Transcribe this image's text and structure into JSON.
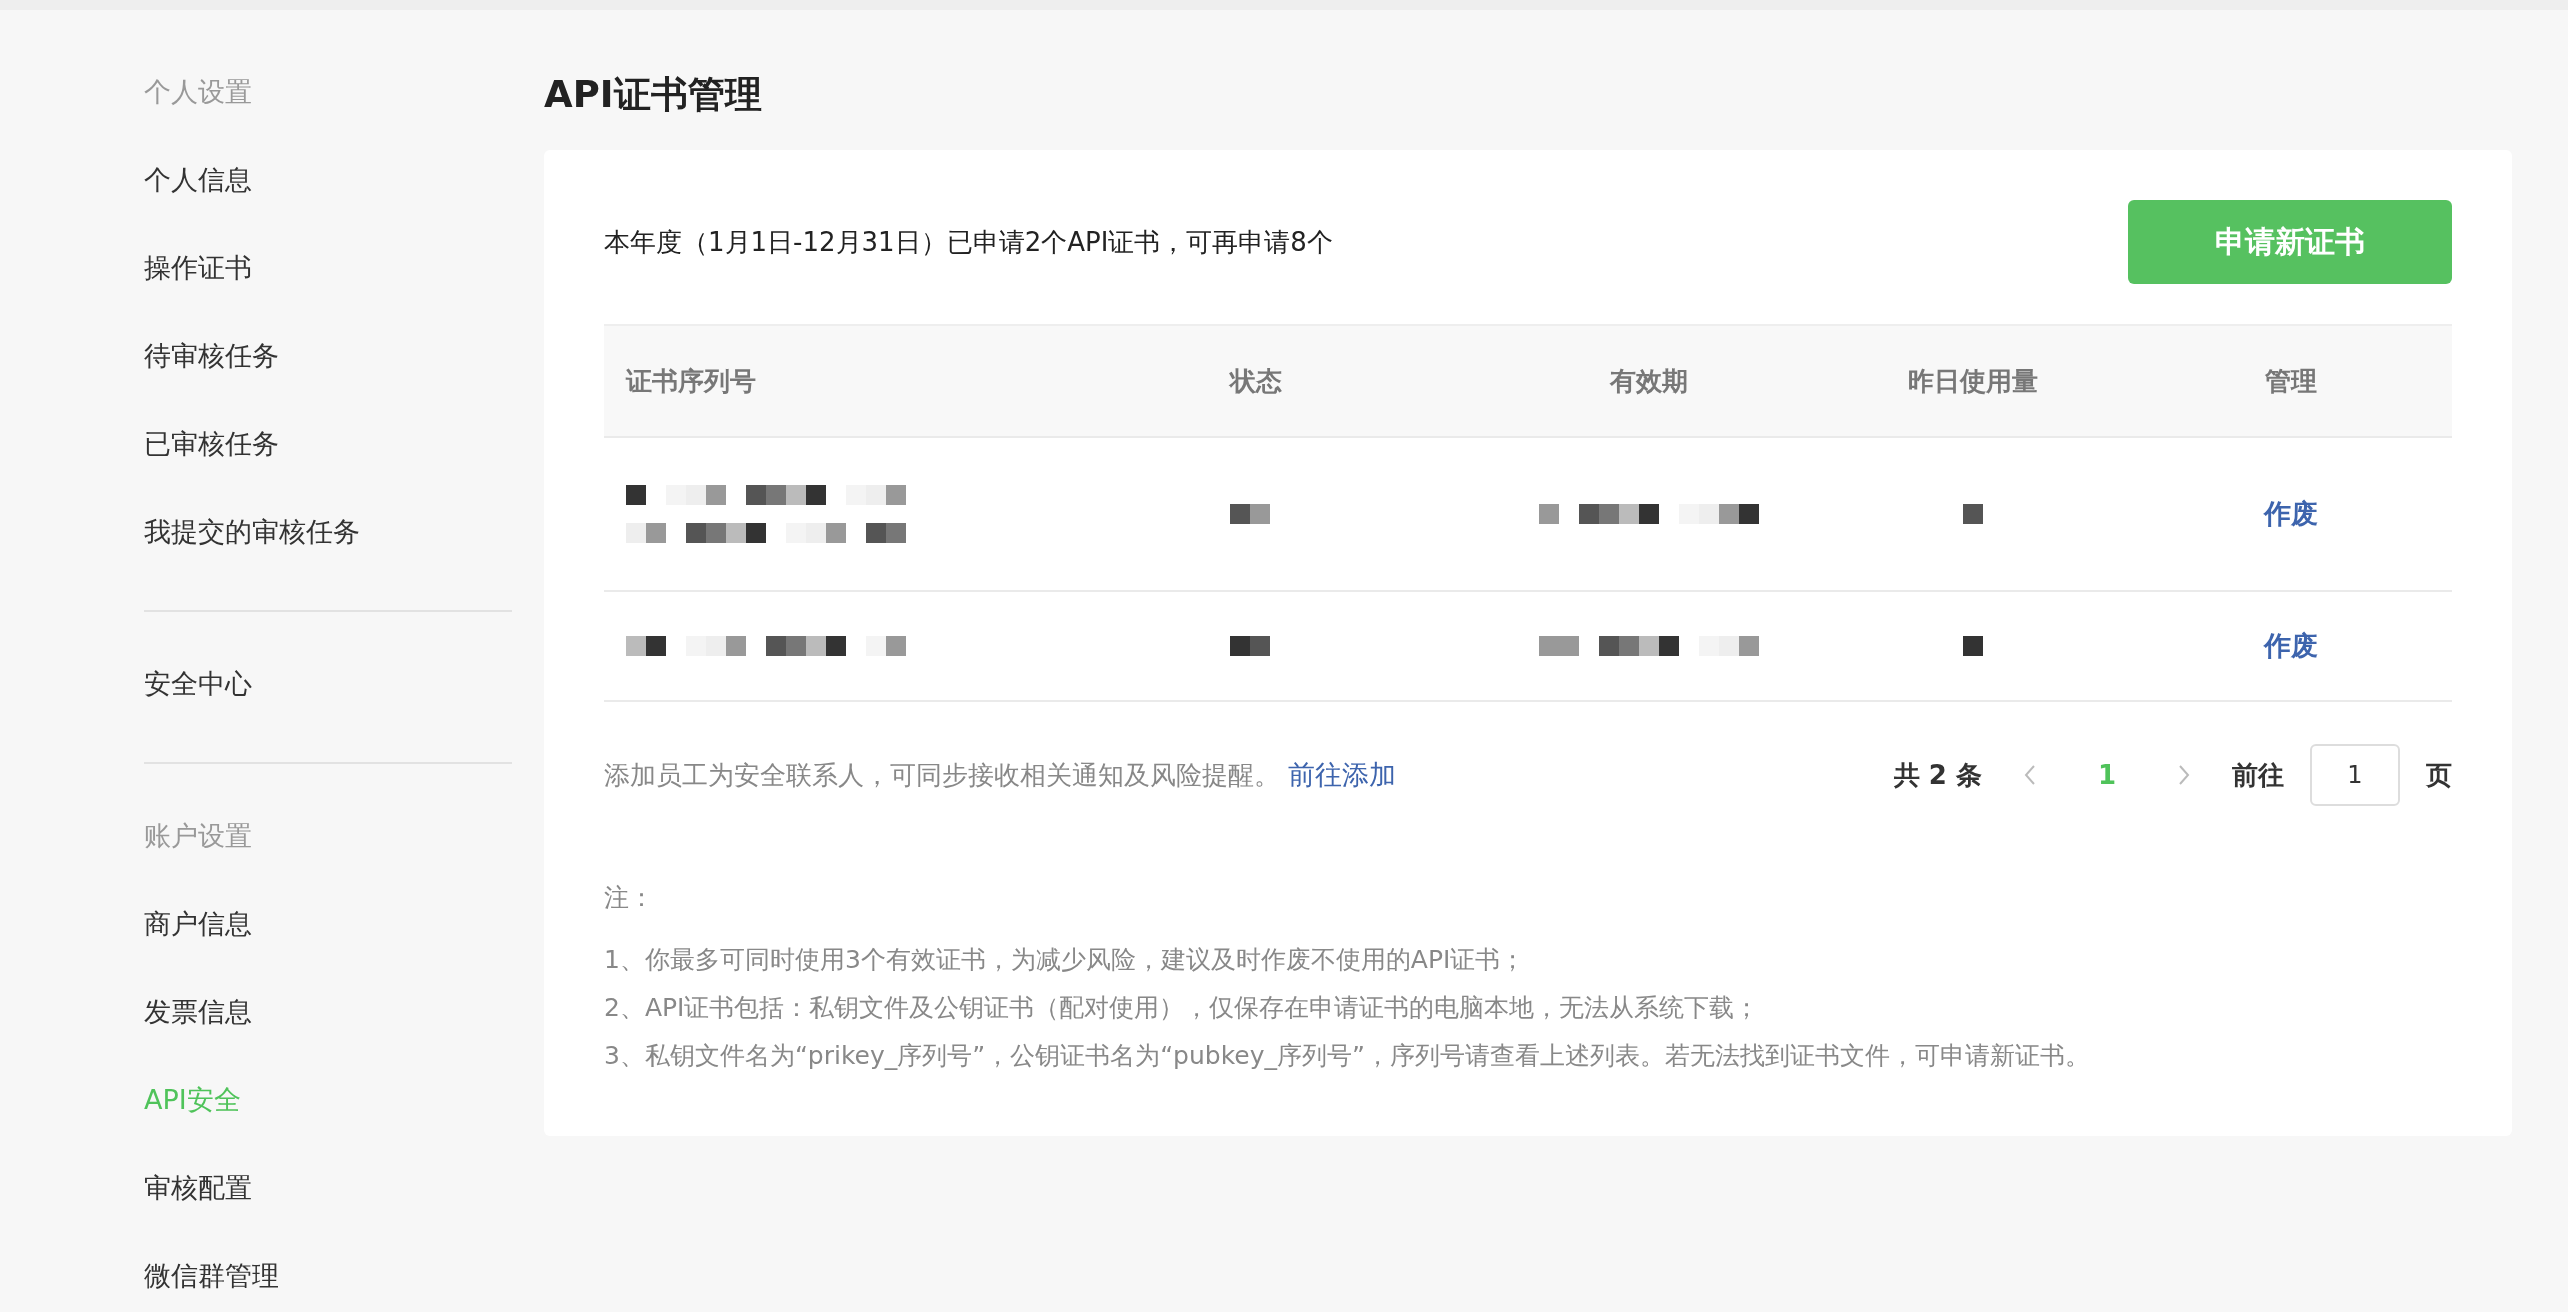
{
  "sidebar": {
    "sections": [
      {
        "heading": "个人设置",
        "items": [
          {
            "label": "个人信息",
            "selected": false
          },
          {
            "label": "操作证书",
            "selected": false
          },
          {
            "label": "待审核任务",
            "selected": false
          },
          {
            "label": "已审核任务",
            "selected": false
          },
          {
            "label": "我提交的审核任务",
            "selected": false
          }
        ]
      },
      {
        "items": [
          {
            "label": "安全中心",
            "selected": false
          }
        ]
      },
      {
        "heading": "账户设置",
        "items": [
          {
            "label": "商户信息",
            "selected": false
          },
          {
            "label": "发票信息",
            "selected": false
          },
          {
            "label": "API安全",
            "selected": true
          },
          {
            "label": "审核配置",
            "selected": false
          },
          {
            "label": "微信群管理",
            "selected": false
          }
        ]
      }
    ]
  },
  "page_title": "API证书管理",
  "quota_text": "本年度（1月1日-12月31日）已申请2个API证书，可再申请8个",
  "apply_button": "申请新证书",
  "table": {
    "columns": [
      "证书序列号",
      "状态",
      "有效期",
      "昨日使用量",
      "管理"
    ],
    "rows": [
      {
        "cells": [
          {
            "kind": "redacted"
          },
          {
            "kind": "redacted"
          },
          {
            "kind": "redacted"
          },
          {
            "kind": "redacted"
          },
          {
            "kind": "link",
            "text": "作废"
          }
        ]
      },
      {
        "cells": [
          {
            "kind": "redacted"
          },
          {
            "kind": "redacted"
          },
          {
            "kind": "redacted"
          },
          {
            "kind": "redacted"
          },
          {
            "kind": "link",
            "text": "作废"
          }
        ]
      }
    ]
  },
  "contact_hint": {
    "text": "添加员工为安全联系人，可同步接收相关通知及风险提醒。",
    "link": "前往添加"
  },
  "pagination": {
    "total": "共 2 条",
    "pages": [
      {
        "label": "1",
        "selected": true
      }
    ],
    "goto_label": "前往",
    "goto_value": "1",
    "page_unit": "页"
  },
  "notes": {
    "heading": "注：",
    "lines": [
      "1、你最多可同时使用3个有效证书，为减少风险，建议及时作废不使用的API证书；",
      "2、API证书包括：私钥文件及公钥证书（配对使用），仅保存在申请证书的电脑本地，无法从系统下载；",
      "3、私钥文件名为“prikey_序列号”，公钥证书名为“pubkey_序列号”，序列号请查看上述列表。若无法找到证书文件，可申请新证书。"
    ]
  }
}
